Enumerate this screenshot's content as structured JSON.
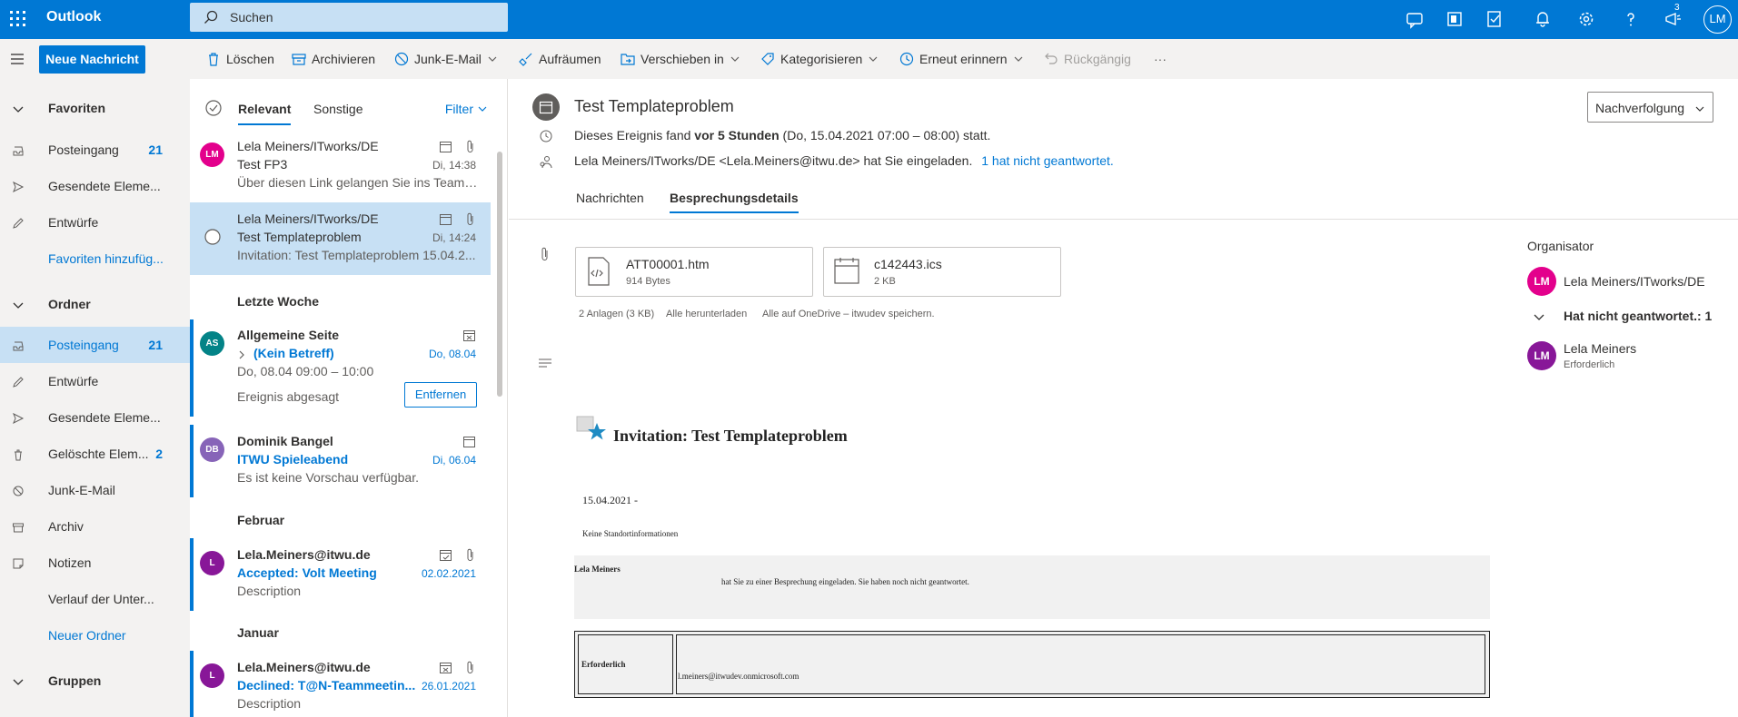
{
  "app": {
    "title": "Outlook",
    "avatar_initials": "LM",
    "notification_count": "3"
  },
  "search": {
    "placeholder": "Suchen"
  },
  "commands": {
    "new_message": "Neue Nachricht",
    "delete": "Löschen",
    "archive": "Archivieren",
    "junk": "Junk-E-Mail",
    "sweep": "Aufräumen",
    "move": "Verschieben in",
    "categorize": "Kategorisieren",
    "snooze": "Erneut erinnern",
    "undo": "Rückgängig",
    "more": "···"
  },
  "nav": {
    "favorites_header": "Favoriten",
    "favorites": [
      {
        "label": "Posteingang",
        "count": "21",
        "icon": "inbox-icon"
      },
      {
        "label": "Gesendete Eleme...",
        "count": "",
        "icon": "send-icon"
      },
      {
        "label": "Entwürfe",
        "count": "",
        "icon": "pencil-icon"
      },
      {
        "label": "Favoriten hinzufüg...",
        "count": "",
        "icon": ""
      }
    ],
    "folders_header": "Ordner",
    "folders": [
      {
        "label": "Posteingang",
        "count": "21",
        "icon": "inbox-icon"
      },
      {
        "label": "Entwürfe",
        "count": "",
        "icon": "pencil-icon"
      },
      {
        "label": "Gesendete Eleme...",
        "count": "",
        "icon": "send-icon"
      },
      {
        "label": "Gelöschte Elem...",
        "count": "2",
        "icon": "trash-icon"
      },
      {
        "label": "Junk-E-Mail",
        "count": "",
        "icon": "block-icon"
      },
      {
        "label": "Archiv",
        "count": "",
        "icon": "archive-icon"
      },
      {
        "label": "Notizen",
        "count": "",
        "icon": "note-icon"
      },
      {
        "label": "Verlauf der Unter...",
        "count": "",
        "icon": ""
      },
      {
        "label": "Neuer Ordner",
        "count": "",
        "icon": ""
      }
    ],
    "groups_header": "Gruppen"
  },
  "list": {
    "tab_focused": "Relevant",
    "tab_other": "Sonstige",
    "filter": "Filter",
    "groups": {
      "last_week": "Letzte Woche",
      "february": "Februar",
      "january": "Januar"
    },
    "messages": [
      {
        "initials": "LM",
        "sender": "Lela Meiners/ITworks/DE",
        "subject": "Test FP3",
        "preview": "Über diesen Link gelangen Sie ins Teams ...",
        "date": "Di, 14:38",
        "color": "#e3008c"
      },
      {
        "initials": "",
        "sender": "Lela Meiners/ITworks/DE",
        "subject": "Test Templateproblem",
        "preview": "Invitation: Test Templateproblem 15.04.2...",
        "date": "Di, 14:24",
        "color": ""
      },
      {
        "initials": "AS",
        "sender": "Allgemeine Seite",
        "subject": "(Kein Betreff)",
        "preview": "Do, 08.04 09:00 – 10:00",
        "status": "Ereignis abgesagt",
        "action": "Entfernen",
        "date": "Do, 08.04",
        "color": "#038387"
      },
      {
        "initials": "DB",
        "sender": "Dominik Bangel",
        "subject": "ITWU Spieleabend",
        "preview": "Es ist keine Vorschau verfügbar.",
        "date": "Di, 06.04",
        "color": "#8764b8"
      },
      {
        "initials": "L",
        "sender": "Lela.Meiners@itwu.de",
        "subject": "Accepted: Volt Meeting",
        "preview": "Description",
        "date": "02.02.2021",
        "color": "#881798"
      },
      {
        "initials": "L",
        "sender": "Lela.Meiners@itwu.de",
        "subject": "Declined: T@N-Teammeetin...",
        "preview": "Description",
        "date": "26.01.2021",
        "color": "#881798"
      }
    ]
  },
  "reading": {
    "title": "Test Templateproblem",
    "followup": "Nachverfolgung",
    "event_prefix": "Dieses Ereignis fand ",
    "event_bold": "vor 5 Stunden",
    "event_suffix": " (Do, 15.04.2021 07:00 – 08:00) statt.",
    "invite_text": "Lela Meiners/ITworks/DE <Lela.Meiners@itwu.de> hat Sie eingeladen.",
    "invite_link": "1 hat nicht geantwortet.",
    "tab_messages": "Nachrichten",
    "tab_details": "Besprechungsdetails",
    "attachments": [
      {
        "name": "ATT00001.htm",
        "size": "914 Bytes",
        "icon": "code-file-icon"
      },
      {
        "name": "c142443.ics",
        "size": "2 KB",
        "icon": "calendar-file-icon"
      }
    ],
    "attach_summary": "2 Anlagen (3 KB)",
    "download_all": "Alle herunterladen",
    "save_all": "Alle auf OneDrive – itwudev speichern.",
    "organizer_header": "Organisator",
    "organizer_initials": "LM",
    "organizer_name": "Lela Meiners/ITworks/DE",
    "noresponse_header": "Hat nicht geantwortet.: 1",
    "attendee_initials": "LM",
    "attendee_name": "Lela Meiners",
    "attendee_role": "Erforderlich",
    "body": {
      "title": "Invitation: Test Templateproblem",
      "date": "15.04.2021 -",
      "location": "Keine Standortinformationen",
      "inviter": "Lela Meiners",
      "invite_msg": "hat Sie zu einer Besprechung eingeladen.  Sie haben noch nicht geantwortet.",
      "required_label": "Erforderlich",
      "required_email": "l.meiners@itwudev.onmicrosoft.com"
    }
  }
}
